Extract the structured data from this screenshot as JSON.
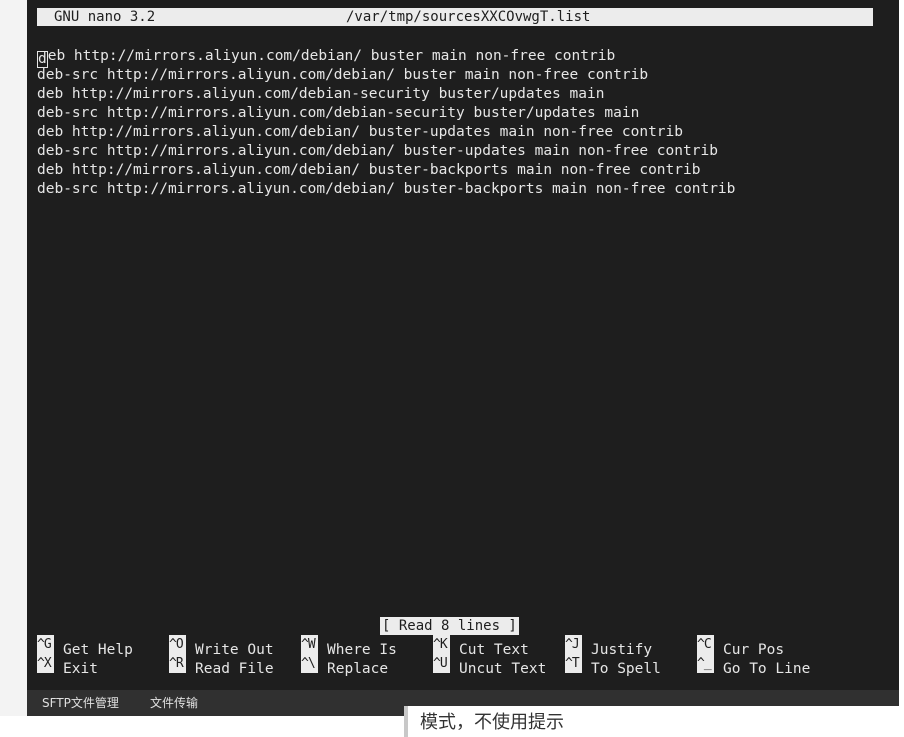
{
  "titlebar": {
    "app": "GNU nano 3.2",
    "file": "/var/tmp/sourcesXXCOvwgT.list"
  },
  "editor": {
    "lines": [
      "deb http://mirrors.aliyun.com/debian/ buster main non-free contrib",
      "deb-src http://mirrors.aliyun.com/debian/ buster main non-free contrib",
      "deb http://mirrors.aliyun.com/debian-security buster/updates main",
      "deb-src http://mirrors.aliyun.com/debian-security buster/updates main",
      "deb http://mirrors.aliyun.com/debian/ buster-updates main non-free contrib",
      "deb-src http://mirrors.aliyun.com/debian/ buster-updates main non-free contrib",
      "deb http://mirrors.aliyun.com/debian/ buster-backports main non-free contrib",
      "deb-src http://mirrors.aliyun.com/debian/ buster-backports main non-free contrib"
    ]
  },
  "status": "[ Read 8 lines ]",
  "shortcuts": [
    {
      "key": "^G",
      "label": "Get Help"
    },
    {
      "key": "^O",
      "label": "Write Out"
    },
    {
      "key": "^W",
      "label": "Where Is"
    },
    {
      "key": "^K",
      "label": "Cut Text"
    },
    {
      "key": "^J",
      "label": "Justify"
    },
    {
      "key": "^C",
      "label": "Cur Pos"
    },
    {
      "key": "^X",
      "label": "Exit"
    },
    {
      "key": "^R",
      "label": "Read File"
    },
    {
      "key": "^\\",
      "label": "Replace"
    },
    {
      "key": "^U",
      "label": "Uncut Text"
    },
    {
      "key": "^T",
      "label": "To Spell"
    },
    {
      "key": "^_",
      "label": "Go To Line"
    }
  ],
  "bottom_tabs": [
    "SFTP文件管理",
    "文件传输"
  ],
  "background_text": "模式，不使用提示",
  "colors": {
    "terminal_bg": "#1e1e1e",
    "inverse_bg": "#ececec",
    "bottom_bar": "#303030"
  }
}
